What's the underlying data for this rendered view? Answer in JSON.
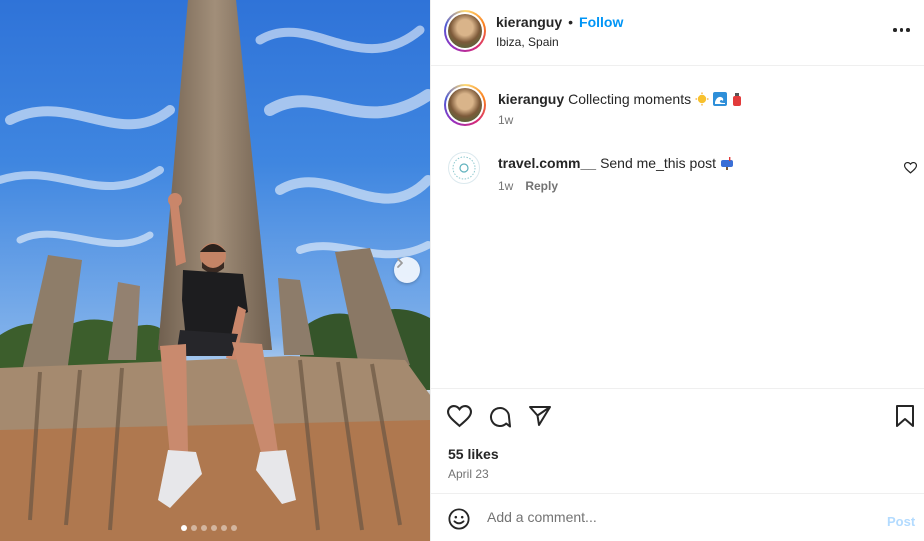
{
  "post": {
    "username": "kieranguy",
    "follow_label": "Follow",
    "separator": "•",
    "location": "Ibiza, Spain"
  },
  "caption": {
    "username": "kieranguy",
    "text": "Collecting moments",
    "emojis": [
      "sun",
      "wave",
      "fire-extinguisher"
    ],
    "time": "1w"
  },
  "comments": [
    {
      "username": "travel.comm__",
      "text": "Send me_this post",
      "emoji": "mailbox",
      "time": "1w",
      "reply_label": "Reply"
    }
  ],
  "stats": {
    "likes": "55 likes",
    "date": "April 23"
  },
  "composer": {
    "placeholder": "Add a comment...",
    "post_label": "Post"
  },
  "carousel": {
    "slide_count": 6,
    "active_index": 0
  },
  "colors": {
    "accent": "#0095f6",
    "post_disabled": "#b3dbff",
    "text": "#262626",
    "muted": "#737373"
  }
}
